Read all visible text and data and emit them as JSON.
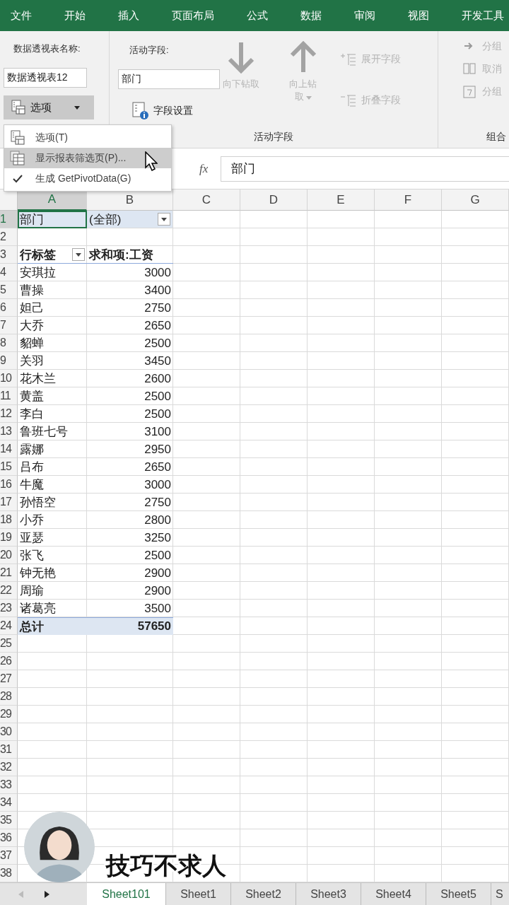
{
  "ribbon_tabs": [
    "文件",
    "开始",
    "插入",
    "页面布局",
    "公式",
    "数据",
    "审阅",
    "视图",
    "开发工具"
  ],
  "ribbon": {
    "pivot_name_label": "数据透视表名称:",
    "pivot_name": "数据透视表12",
    "options_button": {
      "label": "选项",
      "expanded": true
    },
    "active_field_label": "活动字段:",
    "active_field": "部门",
    "field_settings": "字段设置",
    "drill_down": {
      "label": "向下钻取",
      "disabled": true
    },
    "drill_up": {
      "label": "向上钻取",
      "disabled": true
    },
    "expand_field": {
      "label": "展开字段",
      "disabled": true
    },
    "collapse_field": {
      "label": "折叠字段",
      "disabled": true
    },
    "active_field_group": "活动字段",
    "group_items": [
      {
        "label": "分组",
        "kind": "arrow",
        "disabled": true
      },
      {
        "label": "取消",
        "kind": "ungroup",
        "disabled": true
      },
      {
        "label": "分组",
        "kind": "field",
        "disabled": true
      }
    ],
    "group_group": "组合"
  },
  "options_menu": [
    {
      "label": "选项(T)",
      "kind": "options",
      "selected": false,
      "checked": false
    },
    {
      "label": "显示报表筛选页(P)...",
      "kind": "pages",
      "selected": true,
      "checked": false
    },
    {
      "label": "生成 GetPivotData(G)",
      "kind": "plain",
      "selected": false,
      "checked": true
    }
  ],
  "formula_bar": {
    "function_label": "fx",
    "value": "部门"
  },
  "columns": [
    {
      "label": "A",
      "selected": true
    },
    {
      "label": "B",
      "selected": false
    },
    {
      "label": "C",
      "selected": false
    },
    {
      "label": "D",
      "selected": false
    },
    {
      "label": "E",
      "selected": false
    },
    {
      "label": "F",
      "selected": false
    },
    {
      "label": "G",
      "selected": false
    }
  ],
  "rows": [
    {
      "number": "1",
      "selected": true,
      "kind": "filter",
      "cells": [
        "部门",
        "(全部)"
      ]
    },
    {
      "number": "2",
      "selected": false,
      "kind": "blank"
    },
    {
      "number": "3",
      "selected": false,
      "kind": "header",
      "cells": [
        "行标签",
        "求和项:工资"
      ]
    },
    {
      "number": "4",
      "selected": false,
      "kind": "item",
      "cells": [
        "安琪拉",
        "3000"
      ]
    },
    {
      "number": "5",
      "selected": false,
      "kind": "item",
      "cells": [
        "曹操",
        "3400"
      ]
    },
    {
      "number": "6",
      "selected": false,
      "kind": "item",
      "cells": [
        "妲己",
        "2750"
      ]
    },
    {
      "number": "7",
      "selected": false,
      "kind": "item",
      "cells": [
        "大乔",
        "2650"
      ]
    },
    {
      "number": "8",
      "selected": false,
      "kind": "item",
      "cells": [
        "貂蝉",
        "2500"
      ]
    },
    {
      "number": "9",
      "selected": false,
      "kind": "item",
      "cells": [
        "关羽",
        "3450"
      ]
    },
    {
      "number": "10",
      "selected": false,
      "kind": "item",
      "cells": [
        "花木兰",
        "2600"
      ]
    },
    {
      "number": "11",
      "selected": false,
      "kind": "item",
      "cells": [
        "黄盖",
        "2500"
      ]
    },
    {
      "number": "12",
      "selected": false,
      "kind": "item",
      "cells": [
        "李白",
        "2500"
      ]
    },
    {
      "number": "13",
      "selected": false,
      "kind": "item",
      "cells": [
        "鲁班七号",
        "3100"
      ]
    },
    {
      "number": "14",
      "selected": false,
      "kind": "item",
      "cells": [
        "露娜",
        "2950"
      ]
    },
    {
      "number": "15",
      "selected": false,
      "kind": "item",
      "cells": [
        "吕布",
        "2650"
      ]
    },
    {
      "number": "16",
      "selected": false,
      "kind": "item",
      "cells": [
        "牛魔",
        "3000"
      ]
    },
    {
      "number": "17",
      "selected": false,
      "kind": "item",
      "cells": [
        "孙悟空",
        "2750"
      ]
    },
    {
      "number": "18",
      "selected": false,
      "kind": "item",
      "cells": [
        "小乔",
        "2800"
      ]
    },
    {
      "number": "19",
      "selected": false,
      "kind": "item",
      "cells": [
        "亚瑟",
        "3250"
      ]
    },
    {
      "number": "20",
      "selected": false,
      "kind": "item",
      "cells": [
        "张飞",
        "2500"
      ]
    },
    {
      "number": "21",
      "selected": false,
      "kind": "item",
      "cells": [
        "钟无艳",
        "2900"
      ]
    },
    {
      "number": "22",
      "selected": false,
      "kind": "item",
      "cells": [
        "周瑜",
        "2900"
      ]
    },
    {
      "number": "23",
      "selected": false,
      "kind": "item",
      "cells": [
        "诸葛亮",
        "3500"
      ]
    },
    {
      "number": "24",
      "selected": false,
      "kind": "total",
      "cells": [
        "总计",
        "57650"
      ]
    },
    {
      "number": "25",
      "selected": false,
      "kind": "blank"
    },
    {
      "number": "26",
      "selected": false,
      "kind": "blank"
    },
    {
      "number": "27",
      "selected": false,
      "kind": "blank"
    },
    {
      "number": "28",
      "selected": false,
      "kind": "blank"
    },
    {
      "number": "29",
      "selected": false,
      "kind": "blank"
    },
    {
      "number": "30",
      "selected": false,
      "kind": "blank"
    },
    {
      "number": "31",
      "selected": false,
      "kind": "blank"
    },
    {
      "number": "32",
      "selected": false,
      "kind": "blank"
    },
    {
      "number": "33",
      "selected": false,
      "kind": "blank"
    },
    {
      "number": "34",
      "selected": false,
      "kind": "blank"
    },
    {
      "number": "35",
      "selected": false,
      "kind": "blank"
    },
    {
      "number": "36",
      "selected": false,
      "kind": "blank"
    },
    {
      "number": "37",
      "selected": false,
      "kind": "blank"
    },
    {
      "number": "38",
      "selected": false,
      "kind": "blank"
    }
  ],
  "sheet_tabs": [
    {
      "label": "Sheet101",
      "selected": true
    },
    {
      "label": "Sheet1",
      "selected": false
    },
    {
      "label": "Sheet2",
      "selected": false
    },
    {
      "label": "Sheet3",
      "selected": false
    },
    {
      "label": "Sheet4",
      "selected": false
    },
    {
      "label": "Sheet5",
      "selected": false
    },
    {
      "label": "S",
      "selected": false
    }
  ],
  "caption": "技巧不求人"
}
